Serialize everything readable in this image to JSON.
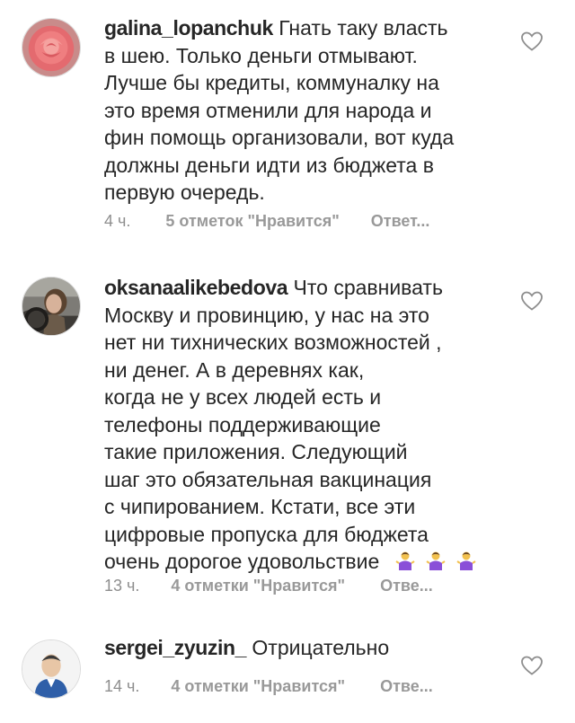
{
  "comments": [
    {
      "username": "galina_lopanchuk",
      "lines": [
        "Гнать таку власть",
        "в шею. Только деньги отмывают.",
        "Лучше бы кредиты, коммуналку на",
        "это время отменили для народа и",
        "фин помощь организовали, вот куда",
        "должны деньги идти из бюджета в",
        "первую очередь."
      ],
      "time": "4 ч.",
      "likes": "5 отметок \"Нравится\"",
      "reply": "Ответ...",
      "avatar": "rose-flower-avatar"
    },
    {
      "username": "oksanaalikebedova",
      "lines": [
        "Что сравнивать",
        "Москву и провинцию,  у нас на это",
        "нет ни тихнических возможностей ,",
        "ни денег. А в деревнях как,",
        "когда не у всех людей есть и",
        "телефоны поддерживающие",
        "такие приложения. Следующий",
        "шаг это обязательная вакцинация",
        "с чипированием. Кстати, все эти",
        "цифровые пропуска для бюджета",
        "очень дорогое удовольствие"
      ],
      "emojis": [
        "person-shrugging-icon",
        "person-shrugging-icon",
        "person-shrugging-icon"
      ],
      "time": "13 ч.",
      "likes": "4 отметки \"Нравится\"",
      "reply": "Отве...",
      "avatar": "woman-in-car-avatar"
    },
    {
      "username": "sergei_zyuzin_",
      "lines": [
        "Отрицательно"
      ],
      "time": "14 ч.",
      "likes": "4 отметки \"Нравится\"",
      "reply": "Отве...",
      "avatar": "man-cartoon-avatar"
    }
  ],
  "colors": {
    "text": "#262626",
    "meta": "#8e8e8e",
    "heart_stroke": "#8e8e8e",
    "emoji": "#8a4fd8"
  }
}
